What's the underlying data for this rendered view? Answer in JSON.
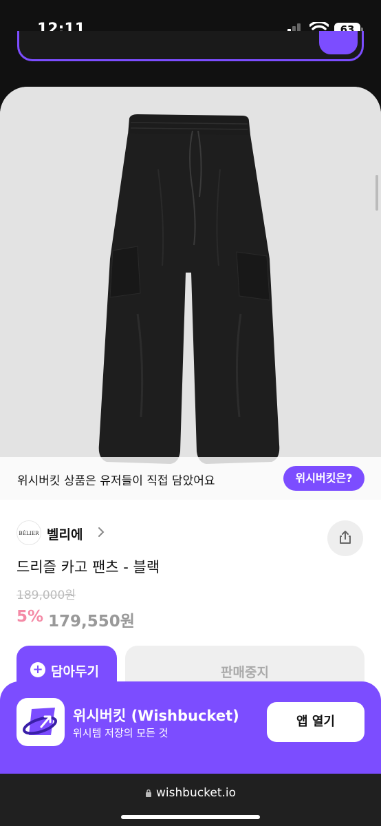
{
  "status": {
    "time": "12:11",
    "battery": "63"
  },
  "notice": {
    "text": "위시버킷 상품은 유저들이 직접 담았어요",
    "button": "위시버킷은?"
  },
  "brand": {
    "logo_text": "BÉLIER",
    "name": "벨리에"
  },
  "product": {
    "title": "드리즐 카고 팬츠 - 블랙",
    "original_price": "189,000원",
    "discount": "5%",
    "price": "179,550원"
  },
  "actions": {
    "wishlist_label": "담아두기",
    "soldout_label": "판매중지"
  },
  "app_banner": {
    "name": "위시버킷 (Wishbucket)",
    "description": "위시템 저장의 모든 것",
    "open_label": "앱 열기"
  },
  "browser": {
    "url": "wishbucket.io"
  },
  "colors": {
    "accent": "#7c4dff",
    "discount": "#f48aa6"
  }
}
